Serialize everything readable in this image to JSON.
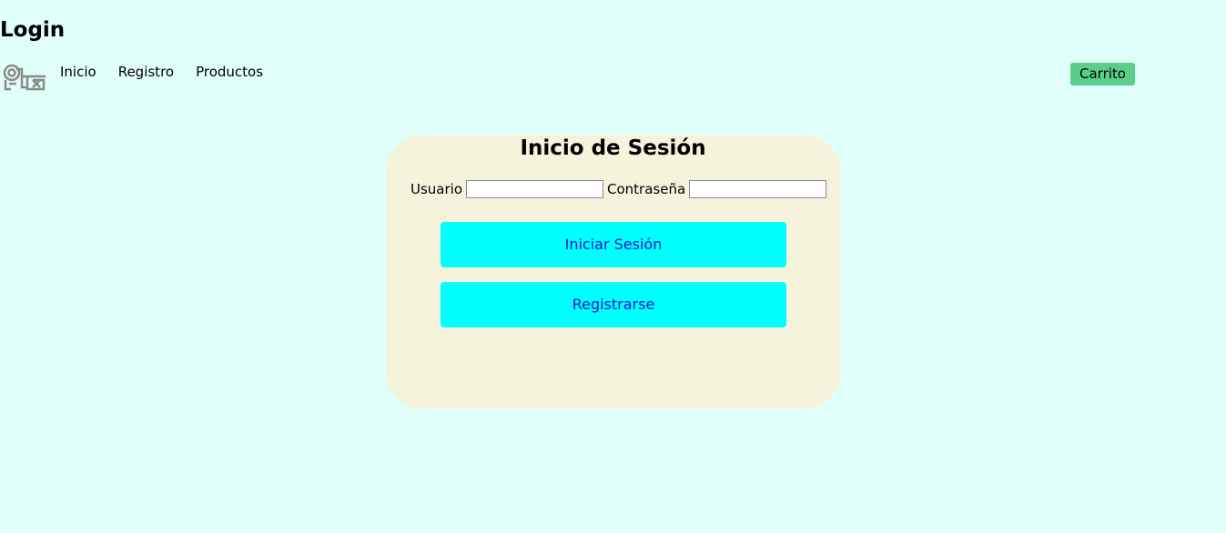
{
  "header": {
    "title": "Login"
  },
  "nav": {
    "items": [
      {
        "label": "Inicio"
      },
      {
        "label": "Registro"
      },
      {
        "label": "Productos"
      }
    ]
  },
  "cart": {
    "label": "Carrito",
    "color": "#5acf8a"
  },
  "login_card": {
    "title": "Inicio de Sesión",
    "username_label": "Usuario",
    "username_value": "",
    "password_label": "Contraseña",
    "password_value": "",
    "submit_label": "Iniciar Sesión",
    "register_label": "Registrarse"
  },
  "colors": {
    "background": "#e0fff9",
    "card": "#f5f3dc",
    "button": "#00ffff",
    "button_text": "#1515c8"
  }
}
